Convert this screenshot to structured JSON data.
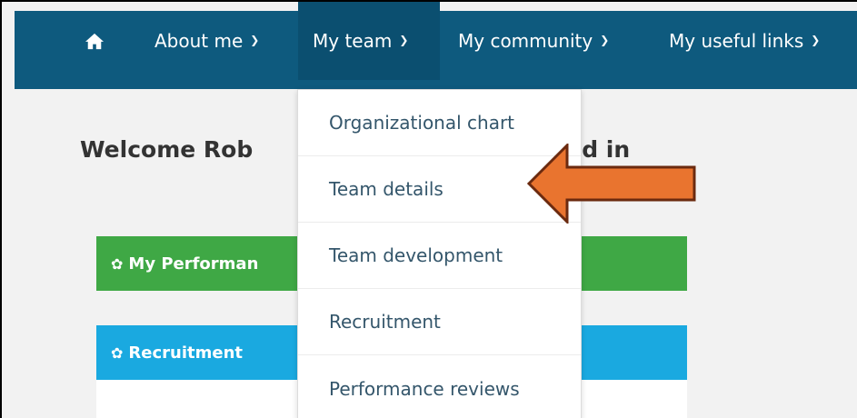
{
  "navbar": {
    "home_icon": "home-icon",
    "items": [
      {
        "label": "About me",
        "chevron": "chevron-down-icon"
      },
      {
        "label": "My team",
        "chevron": "chevron-down-icon",
        "active": true
      },
      {
        "label": "My community",
        "chevron": "chevron-down-icon"
      },
      {
        "label": "My useful links",
        "chevron": "chevron-down-icon"
      }
    ],
    "colors": {
      "background": "#0e5a7e",
      "active": "#0b4f70"
    }
  },
  "main": {
    "welcome_left": "Welcome Rob",
    "welcome_right": "ed in",
    "panels": [
      {
        "label": "My Performan",
        "icon": "leaf-icon",
        "color": "#3fa845"
      },
      {
        "label": "Recruitment",
        "icon": "leaf-icon",
        "color": "#1aa9e0"
      }
    ]
  },
  "dropdown": {
    "items": [
      {
        "label": "Organizational chart"
      },
      {
        "label": "Team details"
      },
      {
        "label": "Team development"
      },
      {
        "label": "Recruitment"
      },
      {
        "label": "Performance reviews"
      }
    ]
  },
  "annotation": {
    "arrow_color": "#e9742f",
    "arrow_outline": "#6b2a0f",
    "points_to": "Team details"
  }
}
